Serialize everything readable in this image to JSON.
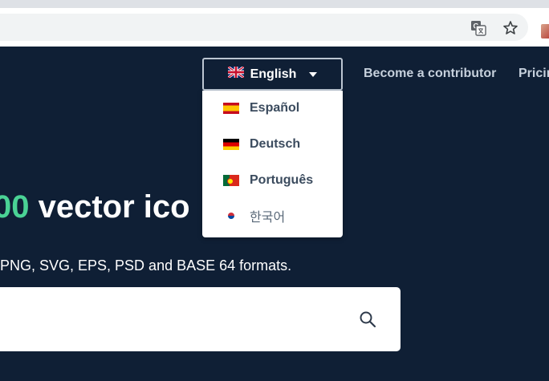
{
  "browser": {
    "toolbar_icons": [
      "translate-icon",
      "star-icon",
      "extension-icon"
    ]
  },
  "header": {
    "language_button": {
      "label": "English",
      "flag": "uk-flag-icon"
    },
    "nav": {
      "contributor_label": "Become a contributor",
      "pricing_label": "Pricin"
    }
  },
  "language_dropdown": {
    "items": [
      {
        "label": "Español",
        "flag": "spain-flag-icon"
      },
      {
        "label": "Deutsch",
        "flag": "germany-flag-icon"
      },
      {
        "label": "Português",
        "flag": "portugal-flag-icon"
      },
      {
        "label": "한국어",
        "flag": "korea-flag-icon"
      }
    ]
  },
  "hero": {
    "title_number": "00",
    "title_text": " vector ico",
    "subtitle": "PNG, SVG, EPS, PSD and BASE 64 formats."
  },
  "search": {
    "value": "",
    "placeholder": ""
  },
  "colors": {
    "background": "#0f1f35",
    "accent_green": "#4ad295",
    "dropdown_text": "#3b4b5e"
  }
}
